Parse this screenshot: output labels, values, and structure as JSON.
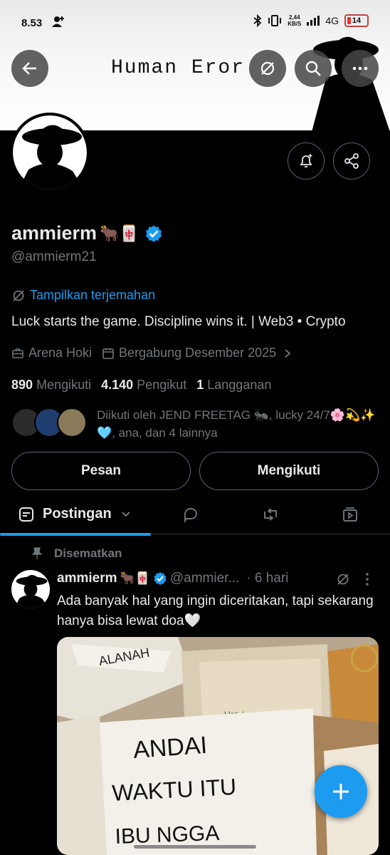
{
  "status_bar": {
    "time": "8.53",
    "speed_value": "2,44",
    "speed_unit": "KB/S",
    "network": "4G",
    "battery": "14"
  },
  "banner": {
    "title": "Human Eror"
  },
  "profile": {
    "display_name": "ammierm",
    "name_emojis": "🐂🀄",
    "handle": "@ammierm21",
    "translate_label": "Tampilkan terjemahan",
    "bio": "Luck starts the game. Discipline wins it. | Web3 • Crypto",
    "location": "Arena Hoki",
    "joined": "Bergabung Desember 2025",
    "following_count": "890",
    "following_label": "Mengikuti",
    "followers_count": "4.140",
    "followers_label": "Pengikut",
    "subs_count": "1",
    "subs_label": "Langganan",
    "followed_by": "Diikuti oleh JEND FREETAG 🐜, lucky 24/7🌸💫✨🩵, ana, dan 4 lainnya"
  },
  "actions": {
    "message_label": "Pesan",
    "follow_label": "Mengikuti"
  },
  "tabs": {
    "posts_label": "Postingan"
  },
  "post": {
    "pinned_label": "Disematkan",
    "author": "ammierm",
    "author_emojis": "🐂🀄",
    "handle": "@ammier...",
    "time": "· 6 hari",
    "text": "Ada banyak hal yang ingin diceritakan, tapi sekarang hanya bisa lewat doa🤍",
    "image_text_1": "ANDAI",
    "image_text_2": "WAKTU  ITU",
    "image_text_3": "IBU  NGGA",
    "image_label": "Untuk"
  },
  "colors": {
    "accent": "#1d9bf0",
    "muted": "#71767b",
    "border": "#536471"
  }
}
